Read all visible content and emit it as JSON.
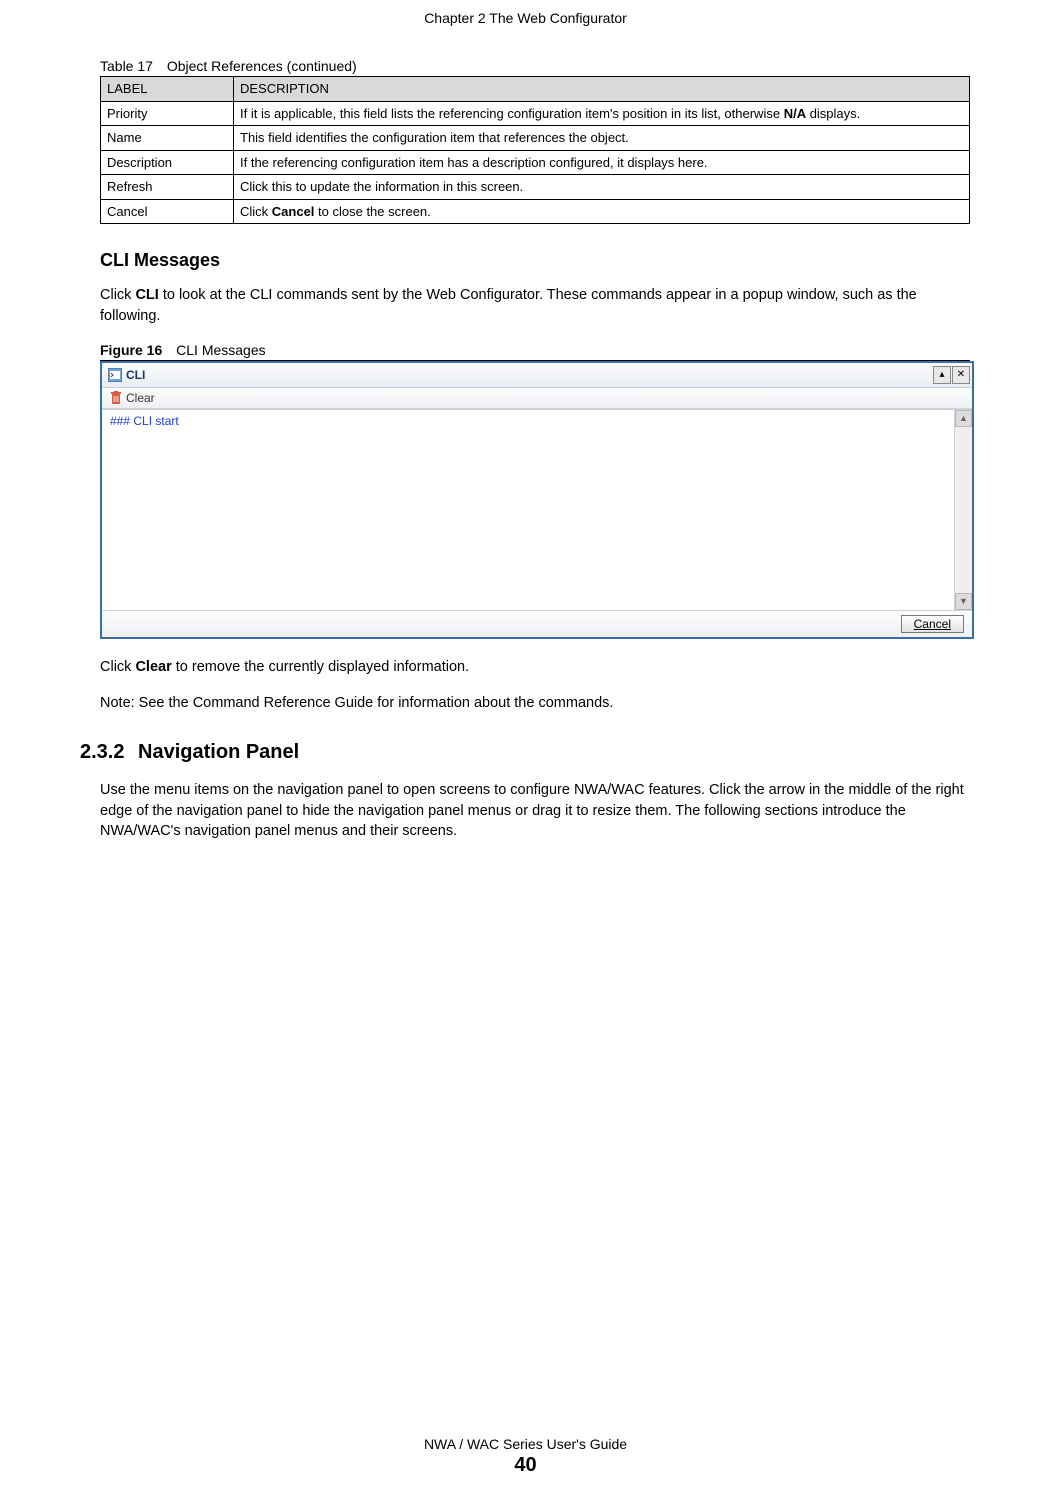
{
  "header": {
    "chapter": "Chapter 2 The Web Configurator"
  },
  "table": {
    "caption_prefix": "Table 17",
    "caption_title": "Object References (continued)",
    "head": {
      "label": "LABEL",
      "description": "DESCRIPTION"
    },
    "rows": [
      {
        "label": "Priority",
        "desc_pre": "If it is applicable, this field lists the referencing configuration item's position in its list, otherwise ",
        "desc_bold": "N/A",
        "desc_post": " displays."
      },
      {
        "label": "Name",
        "desc_pre": "This field identifies the configuration item that references the object.",
        "desc_bold": "",
        "desc_post": ""
      },
      {
        "label": "Description",
        "desc_pre": "If the referencing configuration item has a description configured, it displays here.",
        "desc_bold": "",
        "desc_post": ""
      },
      {
        "label": "Refresh",
        "desc_pre": "Click this to update the information in this screen.",
        "desc_bold": "",
        "desc_post": ""
      },
      {
        "label": "Cancel",
        "desc_pre": "Click ",
        "desc_bold": "Cancel",
        "desc_post": " to close the screen."
      }
    ]
  },
  "cli_heading": "CLI Messages",
  "cli_intro_pre": "Click ",
  "cli_intro_bold": "CLI",
  "cli_intro_post": " to look at the CLI commands sent by the Web Configurator. These commands appear in a popup window, such as the following.",
  "figure": {
    "prefix": "Figure 16",
    "title": "CLI Messages"
  },
  "cli_window": {
    "title": "CLI",
    "clear_label": "Clear",
    "content": "### CLI start",
    "cancel_label": "Cancel"
  },
  "after_fig_pre": "Click ",
  "after_fig_bold": "Clear",
  "after_fig_post": " to remove the currently displayed information.",
  "note": "Note: See the Command Reference Guide for information about the commands.",
  "nav": {
    "number": "2.3.2",
    "heading": "Navigation Panel",
    "para": "Use the menu items on the navigation panel to open screens to configure NWA/WAC features. Click the arrow in the middle of the right edge of the navigation panel to hide the navigation panel menus or drag it to resize them. The following sections introduce the NWA/WAC's navigation panel menus and their screens."
  },
  "footer": {
    "title": "NWA / WAC Series User's Guide",
    "page": "40"
  }
}
